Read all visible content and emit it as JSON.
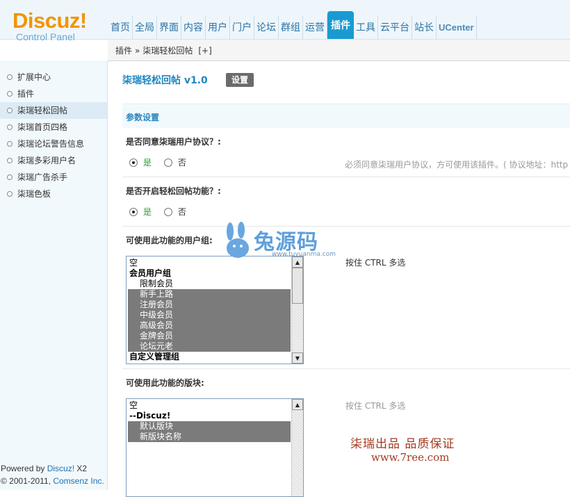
{
  "logo": {
    "main": "Discuz!",
    "sub": "Control Panel"
  },
  "nav": {
    "items": [
      "首页",
      "全局",
      "界面",
      "内容",
      "用户",
      "门户",
      "论坛",
      "群组",
      "运营",
      "插件",
      "工具",
      "云平台",
      "站长",
      "UCenter"
    ],
    "active": "插件"
  },
  "breadcrumb": {
    "root": "插件",
    "sep": "»",
    "current": "柒瑞轻松回帖",
    "add": "[+]"
  },
  "sidebar": {
    "items": [
      "扩展中心",
      "插件",
      "柒瑞轻松回帖",
      "柒瑞首页四格",
      "柒瑞论坛警告信息",
      "柒瑞多彩用户名",
      "柒瑞广告杀手",
      "柒瑞色板"
    ],
    "active": "柒瑞轻松回帖"
  },
  "footer": {
    "powered_prefix": "Powered by ",
    "powered_link": "Discuz!",
    "powered_version": " X2",
    "copyright_prefix": "© 2001-2011, ",
    "copyright_link": "Comsenz Inc."
  },
  "main": {
    "title": "柒瑞轻松回帖 v1.0",
    "settings_button": "设置",
    "section_title": "参数设置",
    "q1": {
      "label": "是否同意柒瑞用户协议？:",
      "yes": "是",
      "no": "否",
      "hint": "必须同意柒瑞用户协议，方可使用该插件。( 协议地址：http"
    },
    "q2": {
      "label": "是否开启轻松回帖功能？:",
      "yes": "是",
      "no": "否"
    },
    "q3": {
      "label": "可使用此功能的用户组:",
      "hint": "按住 CTRL 多选",
      "options": [
        {
          "text": "空",
          "type": "item",
          "selected": false
        },
        {
          "text": "会员用户组",
          "type": "group",
          "selected": false
        },
        {
          "text": "限制会员",
          "type": "indent",
          "selected": false
        },
        {
          "text": "新手上路",
          "type": "indent",
          "selected": true
        },
        {
          "text": "注册会员",
          "type": "indent",
          "selected": true
        },
        {
          "text": "中级会员",
          "type": "indent",
          "selected": true
        },
        {
          "text": "高级会员",
          "type": "indent",
          "selected": true
        },
        {
          "text": "金牌会员",
          "type": "indent",
          "selected": true
        },
        {
          "text": "论坛元老",
          "type": "indent",
          "selected": true
        },
        {
          "text": "自定义管理组",
          "type": "group",
          "selected": false
        }
      ]
    },
    "q4": {
      "label": "可使用此功能的版块:",
      "hint": "按住 CTRL 多选",
      "options": [
        {
          "text": "空",
          "type": "item",
          "selected": false
        },
        {
          "text": "--Discuz!",
          "type": "group",
          "selected": false
        },
        {
          "text": "默认版块",
          "type": "indent",
          "selected": true
        },
        {
          "text": "新版块名称",
          "type": "indent",
          "selected": true
        }
      ]
    },
    "watermark": {
      "text": "兔源码",
      "url": "www.tuyuanma.com"
    },
    "promo": {
      "line1": "柒瑞出品  品质保证",
      "line2": "www.7ree.com"
    }
  },
  "colors": {
    "accent": "#1a9ad0",
    "logo_orange": "#f29400",
    "selected_option": "#7b7b7b",
    "promo_red": "#a43a1f"
  }
}
